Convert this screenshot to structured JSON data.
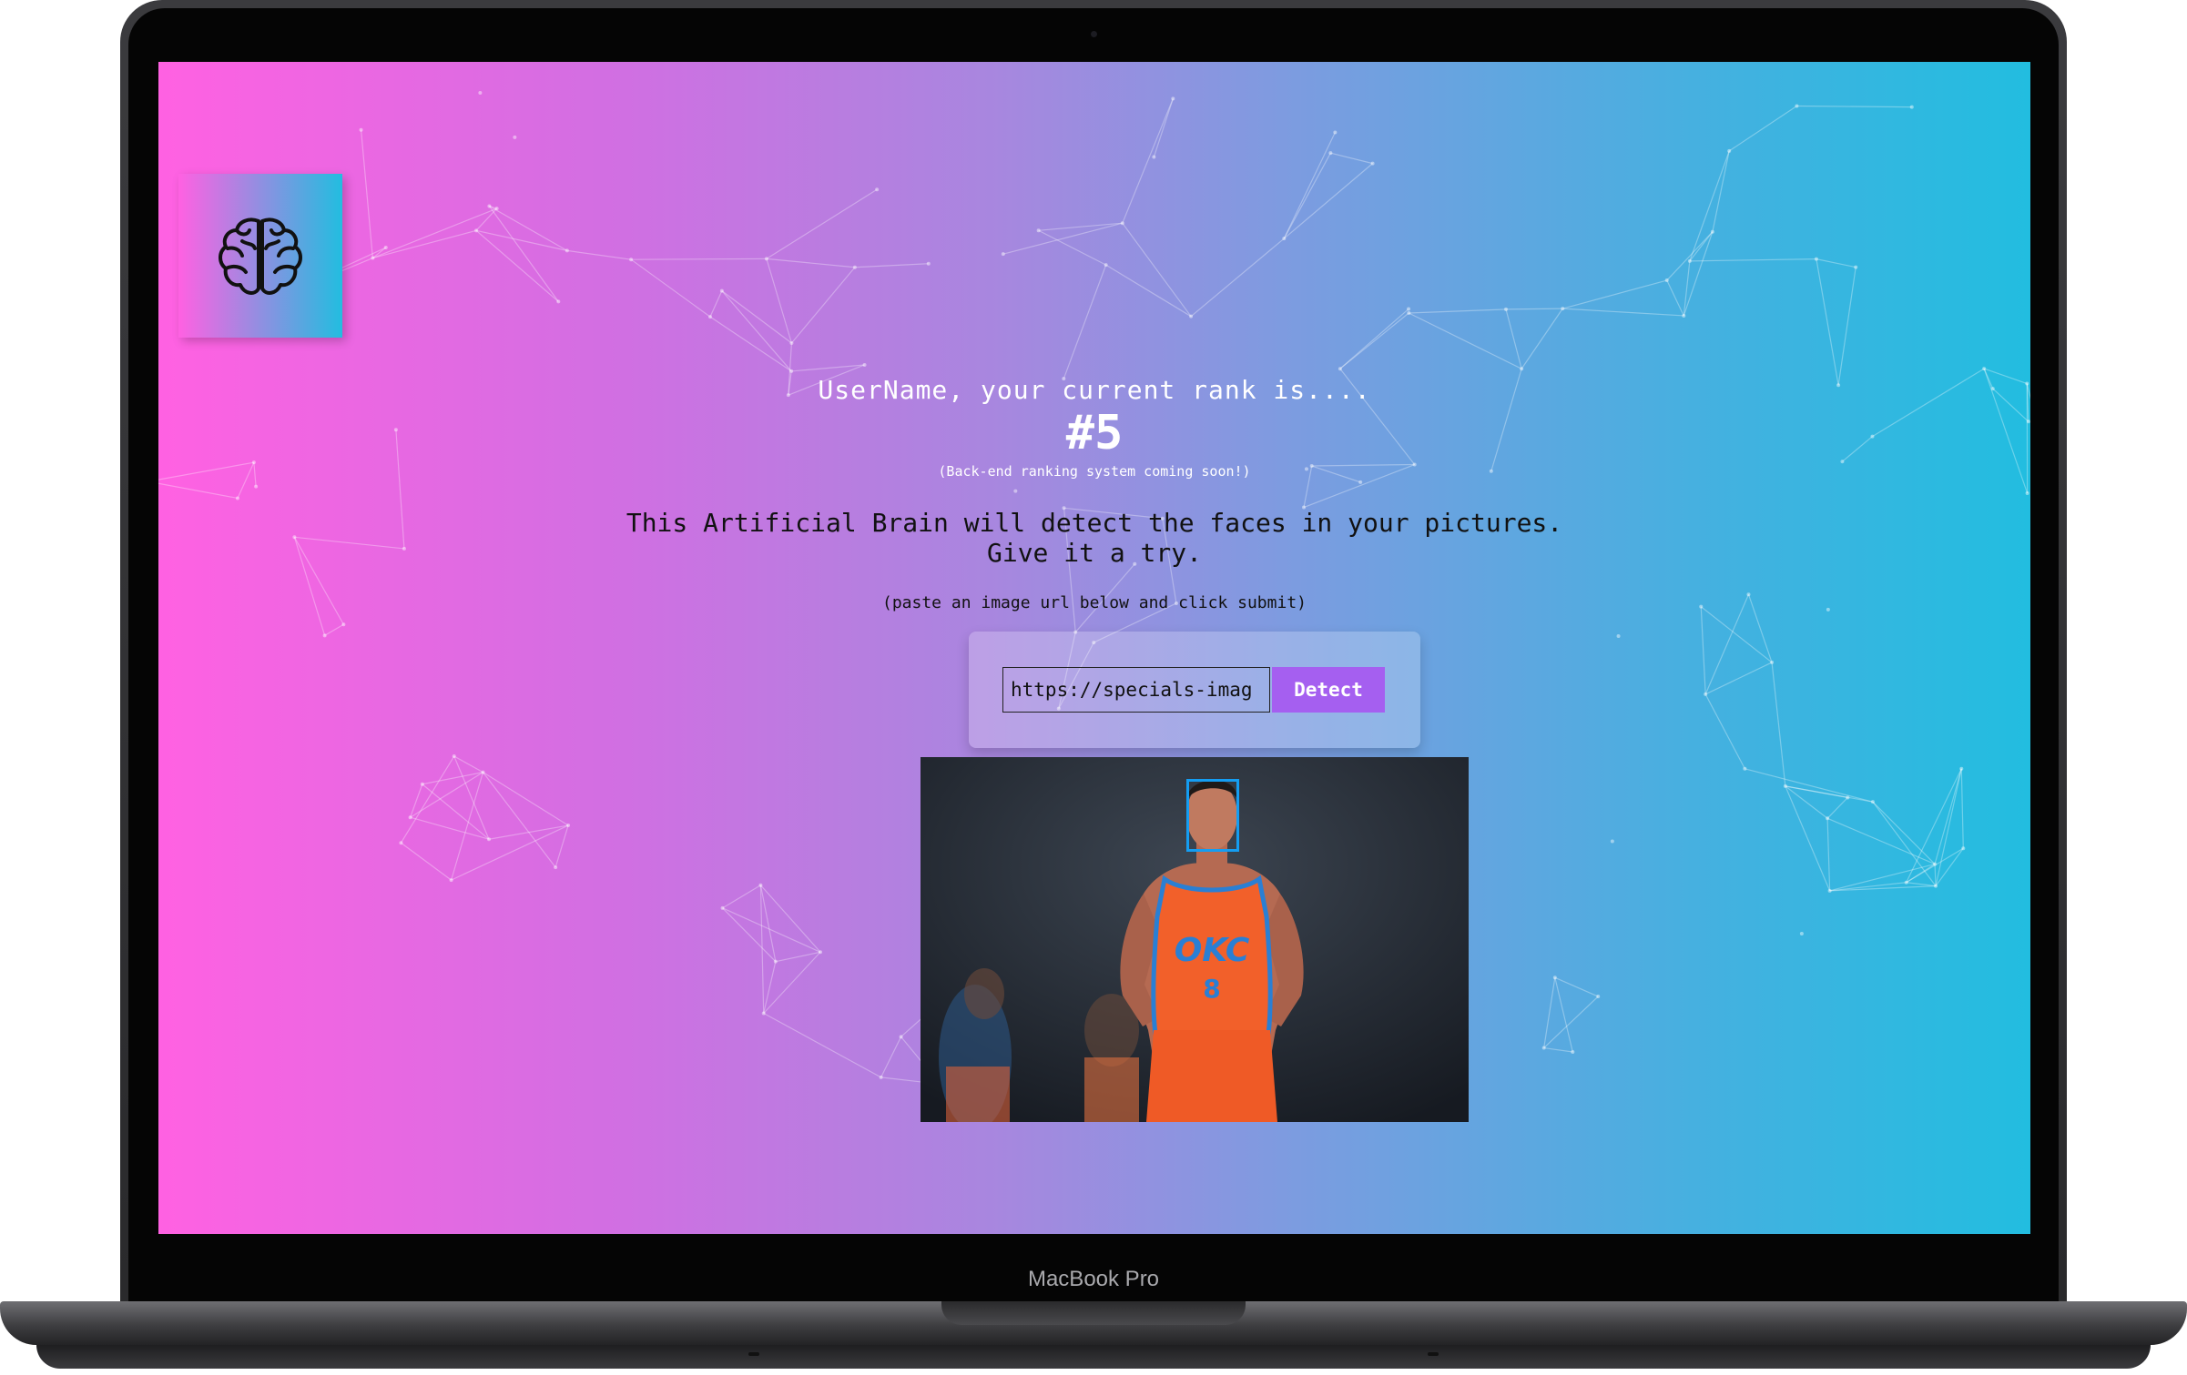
{
  "device": {
    "brand_label": "MacBook Pro"
  },
  "app": {
    "logo_icon": "brain-icon",
    "rank": {
      "message": "UserName, your current rank is....",
      "value": "#5",
      "note": "(Back-end ranking system coming soon!)"
    },
    "intro": {
      "line1": "This Artificial Brain will detect the faces in your pictures.",
      "line2": "Give it a try."
    },
    "hint": "(paste an image url below and click submit)",
    "form": {
      "url_value": "https://specials-imag",
      "detect_label": "Detect"
    },
    "result": {
      "jersey_text": "OKC",
      "jersey_number": "8"
    }
  },
  "colors": {
    "gradient_left": "#ff61e2",
    "gradient_right": "#22bde0",
    "button": "#a55ff0",
    "face_box": "#149df2",
    "jersey": "#f2602a"
  }
}
